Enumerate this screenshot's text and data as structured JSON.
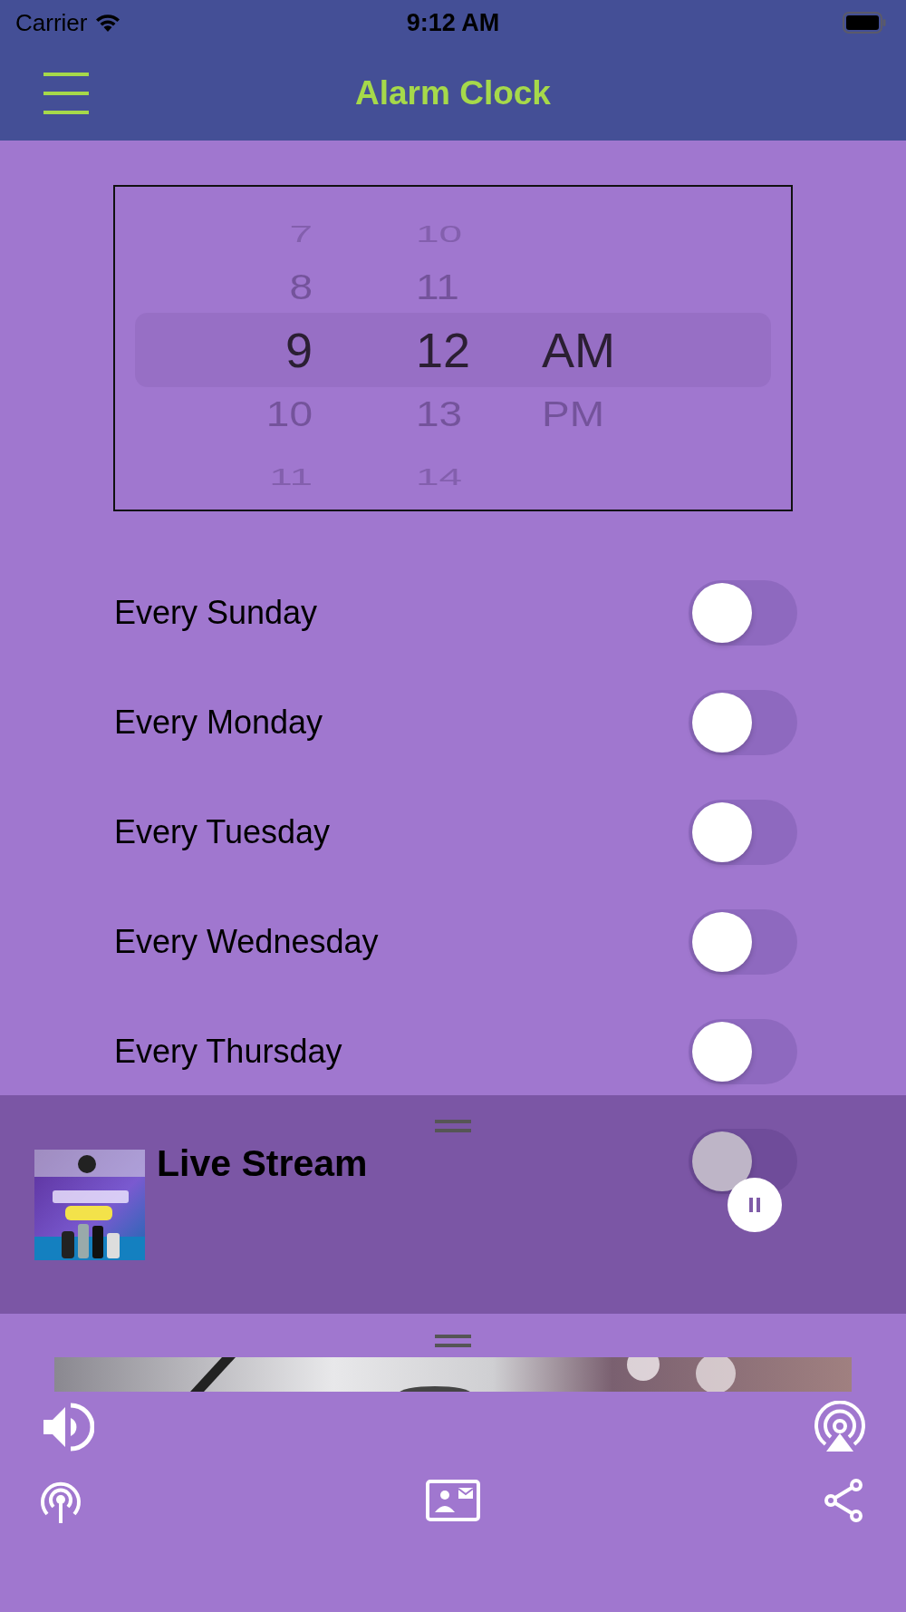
{
  "status_bar": {
    "carrier": "Carrier",
    "time": "9:12 AM"
  },
  "nav_bar": {
    "title": "Alarm Clock"
  },
  "time_picker": {
    "columns": [
      {
        "items": [
          {
            "label": "7",
            "selected": false
          },
          {
            "label": "8",
            "selected": false
          },
          {
            "label": "9",
            "selected": true
          },
          {
            "label": "10",
            "selected": false
          },
          {
            "label": "11",
            "selected": false
          }
        ]
      },
      {
        "items": [
          {
            "label": "10",
            "selected": false
          },
          {
            "label": "11",
            "selected": false
          },
          {
            "label": "12",
            "selected": true
          },
          {
            "label": "13",
            "selected": false
          },
          {
            "label": "14",
            "selected": false
          }
        ]
      },
      {
        "items": [
          {
            "label": "AM",
            "selected": true
          },
          {
            "label": "PM",
            "selected": false
          }
        ]
      }
    ]
  },
  "repeat_days": [
    {
      "label": "Every Sunday",
      "on": false
    },
    {
      "label": "Every Monday",
      "on": false
    },
    {
      "label": "Every Tuesday",
      "on": false
    },
    {
      "label": "Every Wednesday",
      "on": false
    },
    {
      "label": "Every Thursday",
      "on": false
    },
    {
      "on": false
    }
  ],
  "mini_player": {
    "title": "Live Stream",
    "playing": true
  }
}
